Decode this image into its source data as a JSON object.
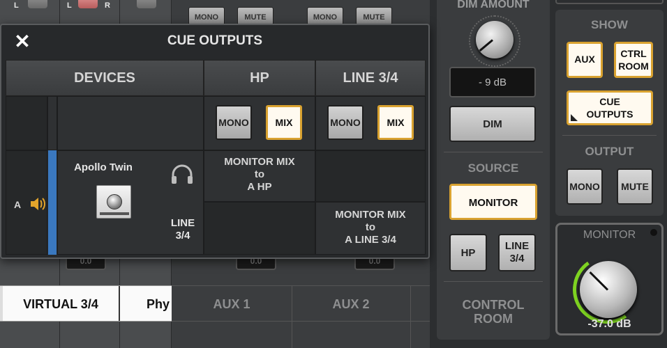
{
  "background": {
    "channel_labels": [
      "L",
      "L",
      "R"
    ],
    "top_buttons": [
      "MONO",
      "MUTE",
      "MONO",
      "MUTE"
    ],
    "fader_caps": [
      "0.0",
      "0.0",
      "0.0"
    ],
    "tabs": [
      "VIRTUAL 3/4",
      "Phy"
    ],
    "aux_labels": [
      "AUX 1",
      "AUX 2"
    ]
  },
  "right_panel": {
    "dim_amount_label": "DIM AMOUNT",
    "dim_value": "- 9 dB",
    "dim_button": "DIM",
    "source_label": "SOURCE",
    "monitor_button": "MONITOR",
    "hp_button": "HP",
    "line34_button": "LINE\n3/4",
    "control_room_label": "CONTROL\nROOM",
    "show_label": "SHOW",
    "aux_button": "AUX",
    "ctrl_room_button": "CTRL\nROOM",
    "cue_outputs_button": "CUE\nOUTPUTS",
    "output_label": "OUTPUT",
    "output_mono_button": "MONO",
    "output_mute_button": "MUTE",
    "monitor_label": "MONITOR",
    "monitor_value": "-37.0 dB",
    "accent_color": "#d9a230",
    "meter_color": "#7ed321"
  },
  "popup": {
    "title": "CUE OUTPUTS",
    "close_icon": "close-icon",
    "headers": [
      "DEVICES",
      "HP",
      "LINE 3/4"
    ],
    "hp_mono": "MONO",
    "hp_mix": "MIX",
    "line_mono": "MONO",
    "line_mix": "MIX",
    "device_letter": "A",
    "device_name": "Apollo Twin",
    "device_outputs_line": "LINE\n3/4",
    "route_hp": "MONITOR MIX\nto\nA HP",
    "route_line": "MONITOR MIX\nto\nA LINE 3/4",
    "device_color": "#3a78bf"
  }
}
